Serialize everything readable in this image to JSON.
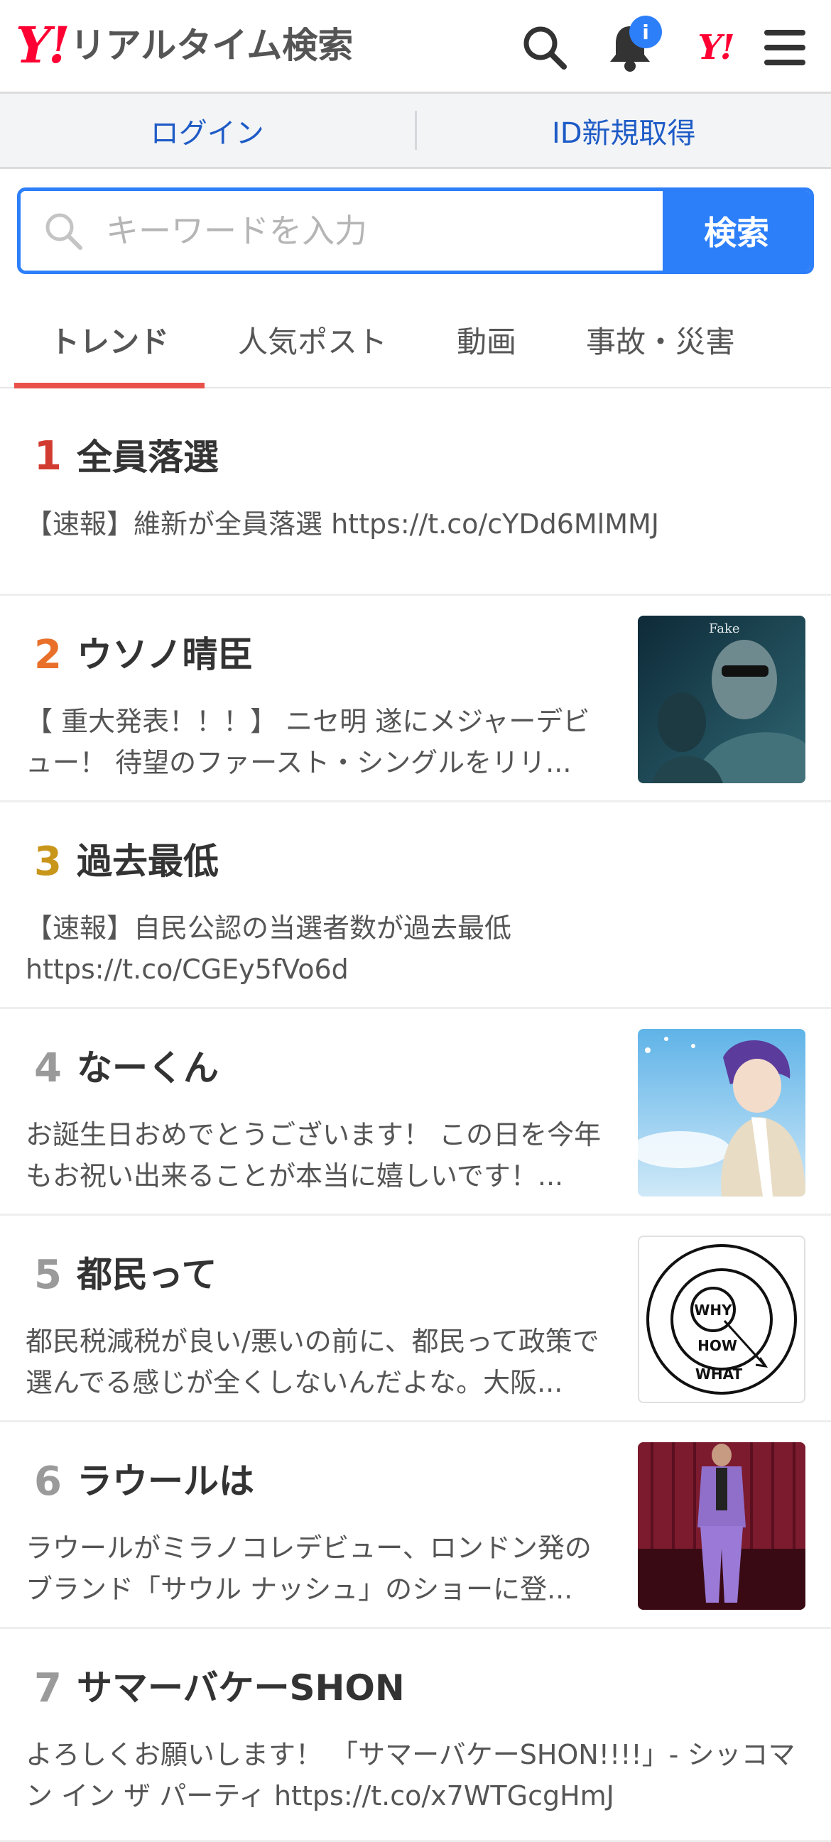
{
  "header": {
    "logo_mark": "Y!",
    "logo_text": "リアルタイム検索",
    "notification_badge": "i",
    "yahoo_mark": "Y!"
  },
  "login_bar": {
    "login_label": "ログイン",
    "signup_label": "ID新規取得"
  },
  "search": {
    "placeholder": "キーワードを入力",
    "button_label": "検索"
  },
  "tabs": [
    {
      "label": "トレンド",
      "active": true
    },
    {
      "label": "人気ポスト",
      "active": false
    },
    {
      "label": "動画",
      "active": false
    },
    {
      "label": "事故・災害",
      "active": false
    }
  ],
  "trends": [
    {
      "rank": "1",
      "title": "全員落選",
      "desc": "【速報】維新が全員落選 https://t.co/cYDd6MlMMJ",
      "rank_color": "#d23b30"
    },
    {
      "rank": "2",
      "title": "ウソノ晴臣",
      "desc": "【 重大発表！！！】 ニセ明 遂にメジャーデビュー！ 待望のファースト・シングルをリリ...",
      "thumb_caption": "Fake",
      "rank_color": "#e8702a"
    },
    {
      "rank": "3",
      "title": "過去最低",
      "desc": "【速報】自民公認の当選者数が過去最低 https://t.co/CGEy5fVo6d",
      "rank_color": "#c9961c"
    },
    {
      "rank": "4",
      "title": "なーくん",
      "desc": "お誕生日おめでとうございます！ この日を今年もお祝い出来ることが本当に嬉しいです！...",
      "rank_color": "#9a9a9a"
    },
    {
      "rank": "5",
      "title": "都民って",
      "desc": "都民税減税が良い/悪いの前に、都民って政策で選んでる感じが全くしないんだよな。大阪...",
      "thumb_words": [
        "WHY",
        "HOW",
        "WHAT"
      ],
      "rank_color": "#9a9a9a"
    },
    {
      "rank": "6",
      "title": "ラウールは",
      "desc": "ラウールがミラノコレデビュー、ロンドン発のブランド「サウル ナッシュ」のショーに登...",
      "rank_color": "#9a9a9a"
    },
    {
      "rank": "7",
      "title": "サマーバケーSHON",
      "desc": "よろしくお願いします！ 「サマーバケーSHON!!!!」- シッコマン イン ザ パーティ https://t.co/x7WTGcgHmJ",
      "rank_color": "#9a9a9a"
    }
  ]
}
